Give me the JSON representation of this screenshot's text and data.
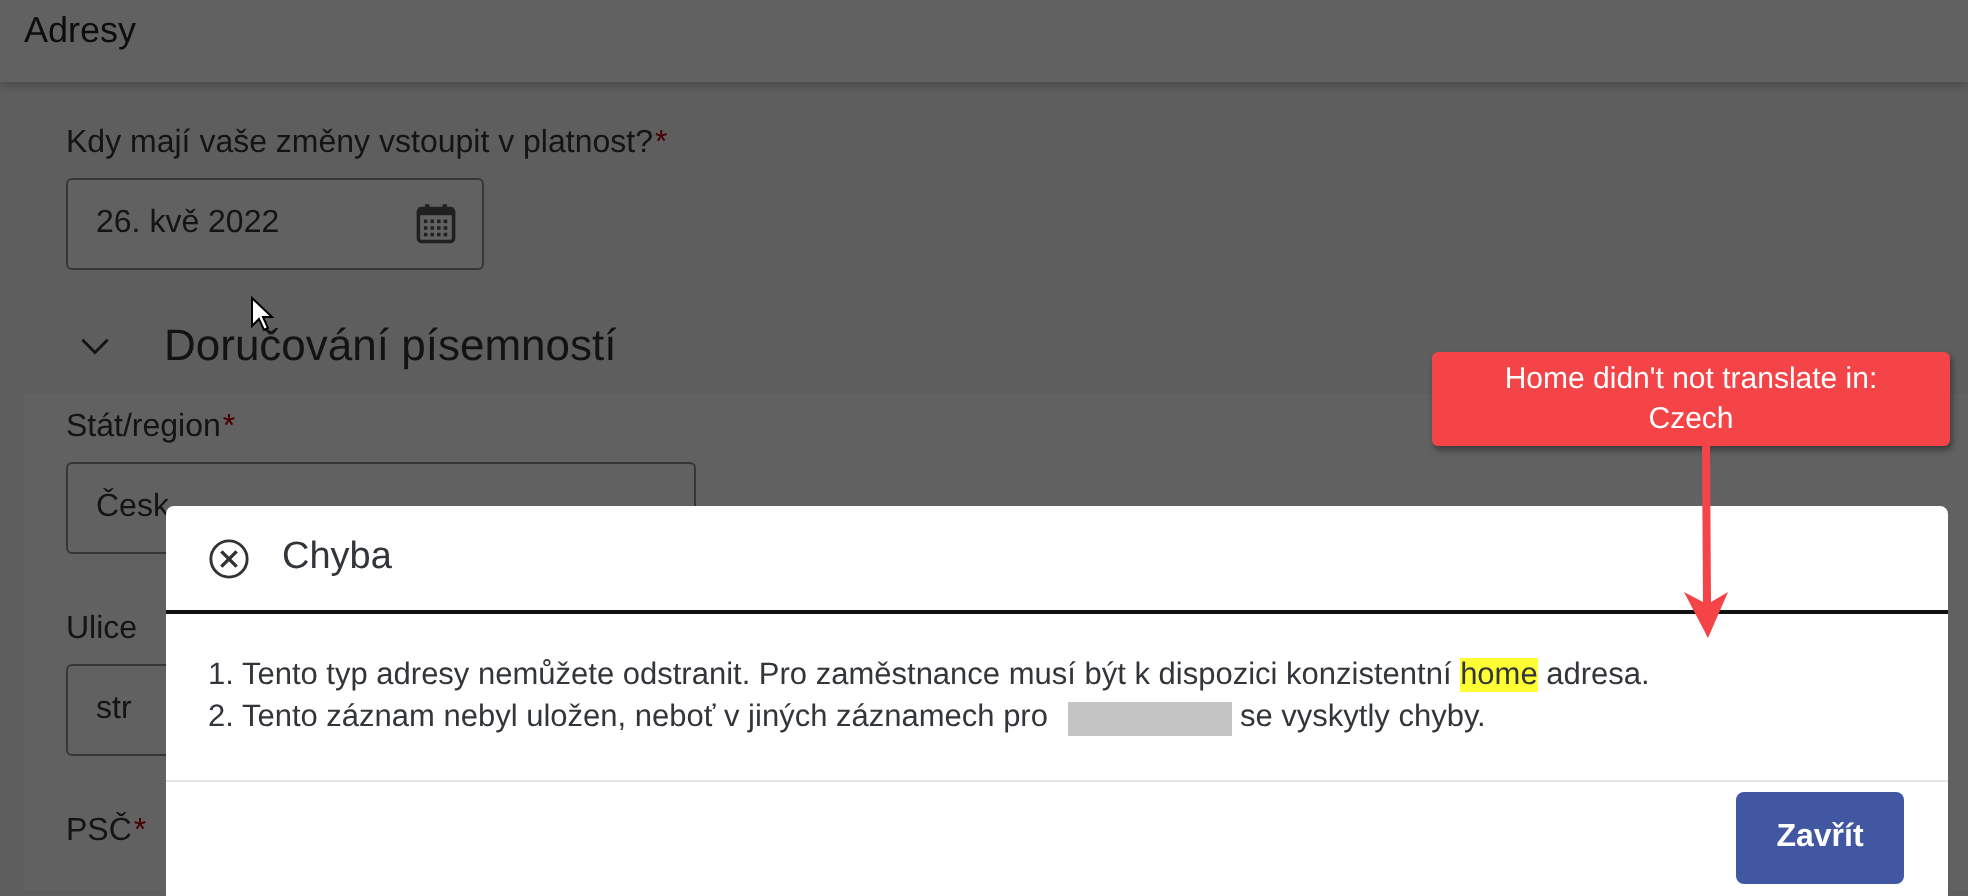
{
  "page": {
    "title": "Adresy",
    "date_field": {
      "label": "Kdy mají vaše změny vstoupit v platnost?",
      "required_mark": "*",
      "value": "26. kvě 2022"
    },
    "section": {
      "title": "Doručování písemností",
      "expanded": true
    },
    "fields": [
      {
        "label": "Stát/region",
        "required_mark": "*",
        "value": "Česk"
      },
      {
        "label": "Ulice",
        "value": "str"
      },
      {
        "label": "PSČ",
        "required_mark": "*"
      }
    ]
  },
  "dialog": {
    "title": "Chyba",
    "messages": [
      {
        "parts": [
          {
            "text": "1. Tento typ adresy nemůžete odstranit. Pro zaměstnance musí být k dispozici konzistentní "
          },
          {
            "text": "home",
            "highlighted": true
          },
          {
            "text": " adresa."
          }
        ]
      },
      {
        "parts": [
          {
            "text": "2. Tento záznam nebyl uložen, neboť v jiných záznamech pro"
          },
          {
            "kind": "redacted"
          },
          {
            "text": "se vyskytly chyby."
          }
        ]
      }
    ],
    "buttons": [
      "Zavřít"
    ]
  },
  "callout": {
    "text": "Home didn't not translate in:\nCzech"
  }
}
